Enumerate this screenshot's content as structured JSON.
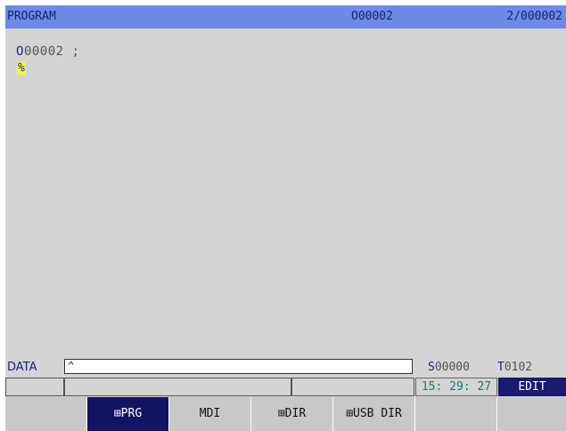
{
  "titlebar": {
    "title": "PROGRAM",
    "program_number": "O00002",
    "count": "2/000002"
  },
  "editor": {
    "line1_first": "O",
    "line1_rest": "00002 ;",
    "line2": "%"
  },
  "data": {
    "label": "DATA",
    "input_value": "^"
  },
  "status": {
    "spindle_prefix": "S",
    "spindle_value": "00000",
    "tool_prefix": "T",
    "tool_value": "0102",
    "time": "15: 29: 27",
    "mode": "EDIT"
  },
  "softkeys": [
    {
      "label": ""
    },
    {
      "label": "⊞PRG",
      "active": true
    },
    {
      "label": "MDI"
    },
    {
      "label": "⊞DIR"
    },
    {
      "label": "⊞USB DIR"
    },
    {
      "label": ""
    },
    {
      "label": ""
    }
  ],
  "colors": {
    "titlebar_bg": "#6c8be4",
    "active_key_bg": "#141466",
    "cursor_highlight": "#f5f542"
  }
}
